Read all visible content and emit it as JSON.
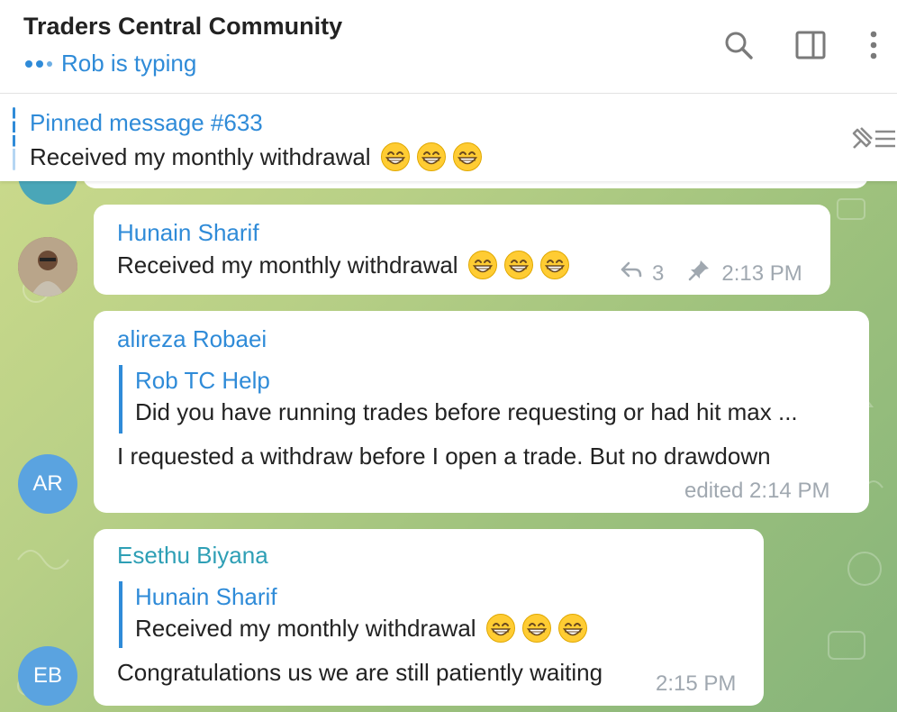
{
  "header": {
    "title": "Traders Central Community",
    "status": "Rob is typing",
    "icons": [
      "search-icon",
      "sidebar-toggle-icon",
      "more-vertical-icon"
    ]
  },
  "pinned": {
    "title": "Pinned message #633",
    "text": "Received my monthly withdrawal",
    "emoji": "grinning-face-with-smiling-eyes"
  },
  "messages": [
    {
      "sender": "Hunain Sharif",
      "sender_color": "#2f8bd8",
      "text": "Received my monthly withdrawal",
      "replies": "3",
      "time": "2:13 PM",
      "pinned": true
    },
    {
      "sender": "alireza Robaei",
      "sender_color": "#2f8bd8",
      "avatar_initials": "AR",
      "avatar_color": "#5aa3e0",
      "quote_name": "Rob TC Help",
      "quote_text": "Did you have running trades before requesting or had hit max ...",
      "text": "I requested a withdraw before I open a trade. But no drawdown",
      "time": "edited 2:14 PM"
    },
    {
      "sender": "Esethu Biyana",
      "sender_color": "#2e9fb5",
      "avatar_initials": "EB",
      "avatar_color": "#5aa3e0",
      "quote_name": "Hunain Sharif",
      "quote_text": "Received my monthly withdrawal",
      "text": "Congratulations us we are still patiently waiting",
      "time": "2:15 PM"
    }
  ],
  "colors": {
    "accent": "#2f8bd8",
    "chat_bg": "#b7cf86"
  }
}
